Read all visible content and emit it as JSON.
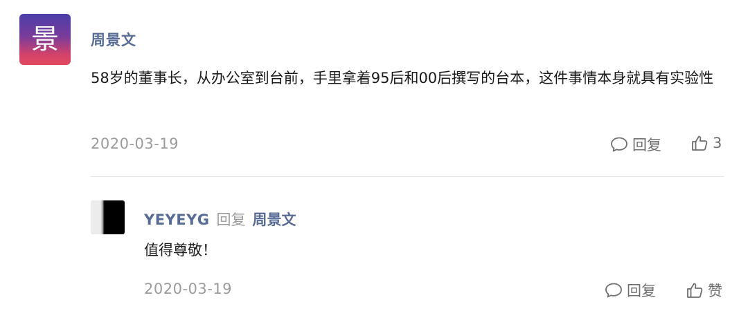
{
  "comment": {
    "avatar_glyph": "景",
    "author": "周景文",
    "content": "58岁的董事长，从办公室到台前，手里拿着95后和00后撰写的台本，这件事情本身就具有实验性",
    "date": "2020-03-19",
    "reply_label": "回复",
    "like_count": "3"
  },
  "reply": {
    "author": "YEYEYG",
    "reply_word": "回复",
    "target": "周景文",
    "content": "值得尊敬！",
    "date": "2020-03-19",
    "reply_label": "回复",
    "like_label": "赞"
  },
  "icons": {
    "reply": "speech-bubble-icon",
    "like": "thumbs-up-icon"
  },
  "colors": {
    "author": "#576b95",
    "meta": "#9b9b9b",
    "divider": "#e6e6e6"
  }
}
